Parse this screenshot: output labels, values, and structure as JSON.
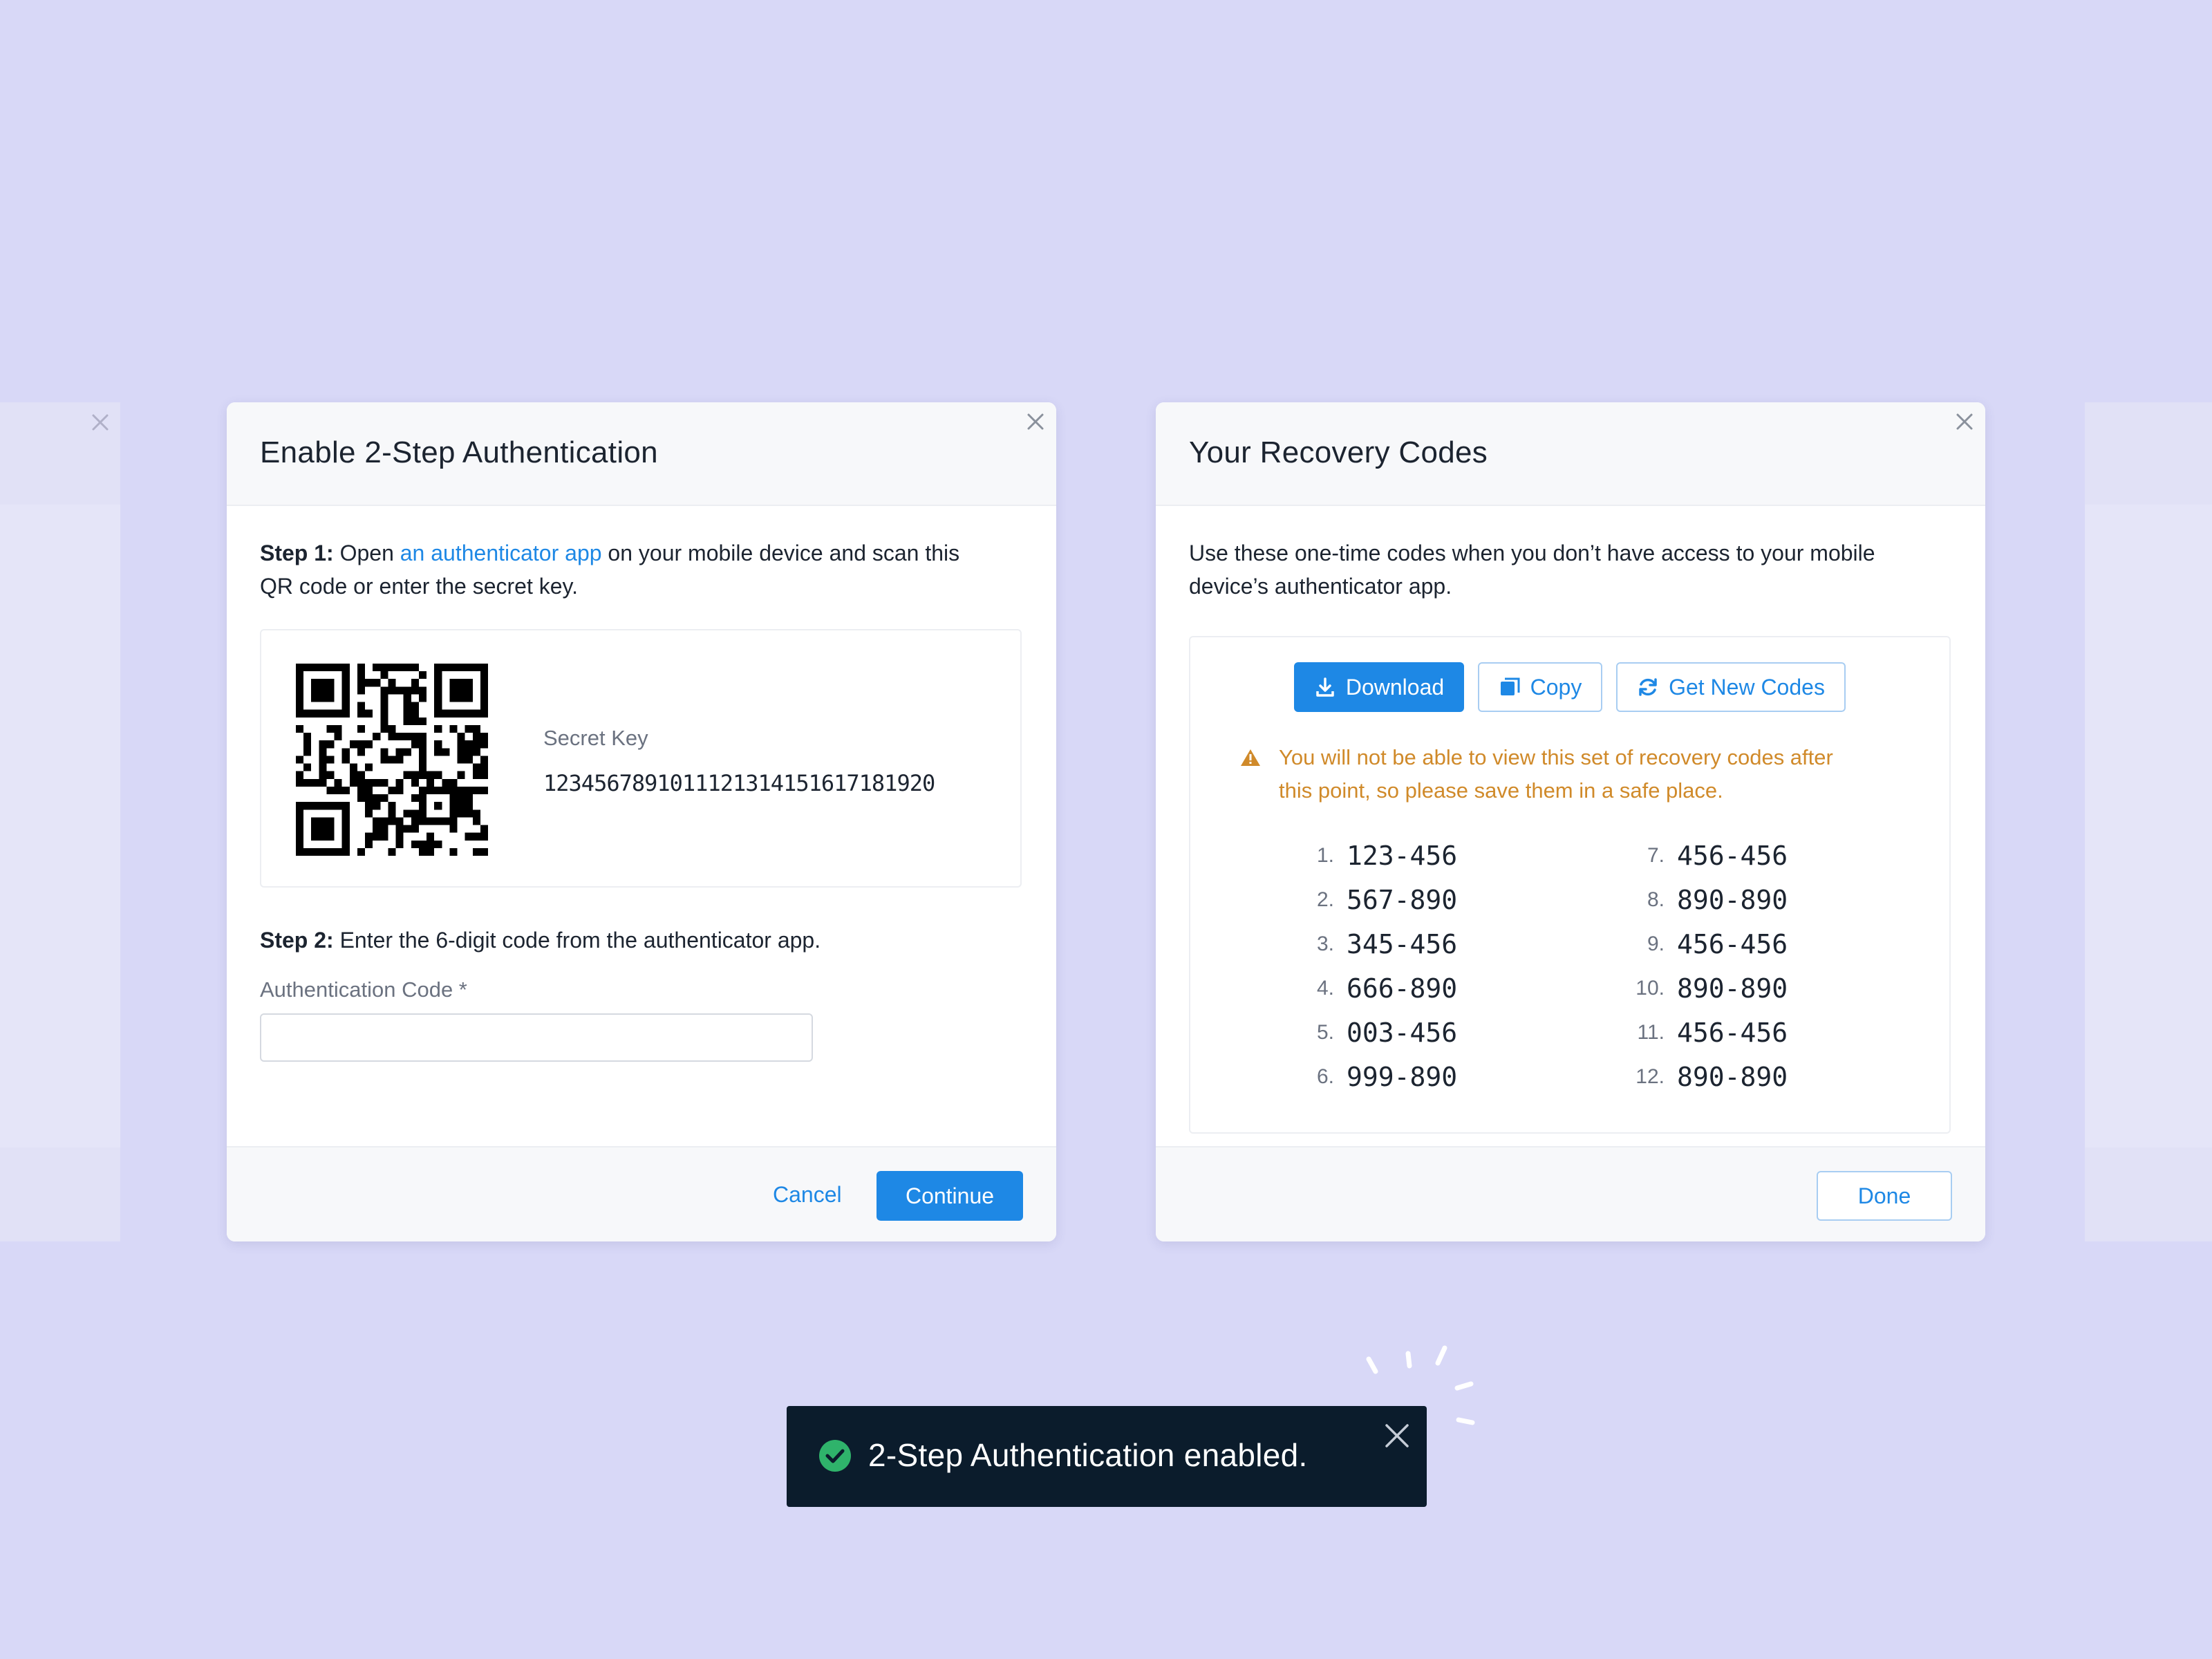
{
  "left_modal": {
    "title": "Enable 2-Step Authentication",
    "step1_label": "Step 1:",
    "step1_pre": " Open ",
    "step1_link": "an authenticator app",
    "step1_post": " on your mobile device and scan this",
    "step1_line2": "QR code or enter the secret key.",
    "secret_key_label": "Secret Key",
    "secret_key_value": "12345678910111213141516171819​20",
    "step2_label": "Step 2:",
    "step2_text": " Enter the 6-digit code from the authenticator app.",
    "auth_code_label": "Authentication Code *",
    "auth_code_value": "",
    "cancel_label": "Cancel",
    "continue_label": "Continue"
  },
  "right_modal": {
    "title": "Your Recovery Codes",
    "intro_line1": "Use these one-time codes when you don’t have access to your mobile",
    "intro_line2": "device’s authenticator app.",
    "download_label": "Download",
    "copy_label": "Copy",
    "new_codes_label": "Get New Codes",
    "warning_line1": "You will not be able to view this set of recovery codes after",
    "warning_line2": "this point, so please save them in a safe place.",
    "codes": [
      {
        "num": "1.",
        "code": "123-456"
      },
      {
        "num": "2.",
        "code": "567-890"
      },
      {
        "num": "3.",
        "code": "345-456"
      },
      {
        "num": "4.",
        "code": "666-890"
      },
      {
        "num": "5.",
        "code": "003-456"
      },
      {
        "num": "6.",
        "code": "999-890"
      },
      {
        "num": "7.",
        "code": "456-456"
      },
      {
        "num": "8.",
        "code": "890-890"
      },
      {
        "num": "9.",
        "code": "456-456"
      },
      {
        "num": "10.",
        "code": "890-890"
      },
      {
        "num": "11.",
        "code": "456-456"
      },
      {
        "num": "12.",
        "code": "890-890"
      }
    ],
    "done_label": "Done"
  },
  "toast": {
    "message": "2-Step Authentication enabled."
  },
  "colors": {
    "background": "#d8d8f7",
    "accent": "#1e88e5",
    "warning": "#d08a2a",
    "success": "#2fb36b",
    "toast_bg": "#0b1c2c"
  },
  "icons": {
    "close": "close-icon",
    "download": "download-icon",
    "copy": "copy-icon",
    "refresh": "refresh-icon",
    "warning": "warning-icon",
    "success": "check-circle-icon"
  }
}
